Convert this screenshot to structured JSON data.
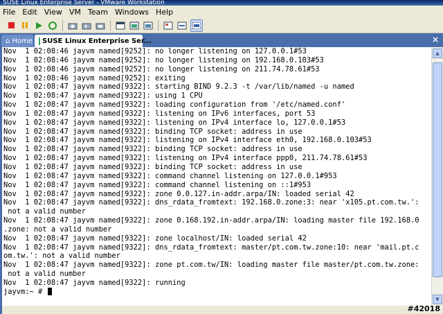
{
  "window": {
    "title": "SUSE Linux Enterprise Server - VMware Workstation"
  },
  "menu": [
    "File",
    "Edit",
    "View",
    "VM",
    "Team",
    "Windows",
    "Help"
  ],
  "toolbar": {
    "icons": [
      "stop-icon",
      "pause-icon",
      "play-icon",
      "reset-icon",
      "snapshot-icon",
      "revert-snapshot-icon",
      "snapshot-manager-icon",
      "fullscreen-icon",
      "quick-switch-icon",
      "summary-view-icon",
      "console-view-icon",
      "appliance-view-icon"
    ]
  },
  "tabs": [
    {
      "label": "Home",
      "icon": "home-icon"
    },
    {
      "label": "SUSE Linux Enterprise Ser...",
      "icon": "vm-icon"
    }
  ],
  "console": {
    "lines": [
      "Nov  1 02:08:46 jayvm named[9252]: no longer listening on 127.0.0.1#53",
      "Nov  1 02:08:46 jayvm named[9252]: no longer listening on 192.168.0.103#53",
      "Nov  1 02:08:46 jayvm named[9252]: no longer listening on 211.74.78.61#53",
      "Nov  1 02:08:46 jayvm named[9252]: exiting",
      "Nov  1 02:08:47 jayvm named[9322]: starting BIND 9.2.3 -t /var/lib/named -u named",
      "Nov  1 02:08:47 jayvm named[9322]: using 1 CPU",
      "Nov  1 02:08:47 jayvm named[9322]: loading configuration from '/etc/named.conf'",
      "Nov  1 02:08:47 jayvm named[9322]: listening on IPv6 interfaces, port 53",
      "Nov  1 02:08:47 jayvm named[9322]: listening on IPv4 interface lo, 127.0.0.1#53",
      "Nov  1 02:08:47 jayvm named[9322]: binding TCP socket: address in use",
      "Nov  1 02:08:47 jayvm named[9322]: listening on IPv4 interface eth0, 192.168.0.103#53",
      "Nov  1 02:08:47 jayvm named[9322]: binding TCP socket: address in use",
      "Nov  1 02:08:47 jayvm named[9322]: listening on IPv4 interface ppp0, 211.74.78.61#53",
      "Nov  1 02:08:47 jayvm named[9322]: binding TCP socket: address in use",
      "Nov  1 02:08:47 jayvm named[9322]: command channel listening on 127.0.0.1#953",
      "Nov  1 02:08:47 jayvm named[9322]: command channel listening on ::1#953",
      "Nov  1 02:08:47 jayvm named[9322]: zone 0.0.127.in-addr.arpa/IN: loaded serial 42",
      "Nov  1 02:08:47 jayvm named[9322]: dns_rdata_fromtext: 192.168.0.zone:3: near 'x105.pt.com.tw.':",
      " not a valid number",
      "Nov  1 02:08:47 jayvm named[9322]: zone 0.168.192.in-addr.arpa/IN: loading master file 192.168.0",
      ".zone: not a valid number",
      "Nov  1 02:08:47 jayvm named[9322]: zone localhost/IN: loaded serial 42",
      "Nov  1 02:08:47 jayvm named[9322]: dns_rdata_fromtext: master/pt.com.tw.zone:10: near 'mail.pt.c",
      "om.tw.': not a valid number",
      "Nov  1 02:08:47 jayvm named[9322]: zone pt.com.tw/IN: loading master file master/pt.com.tw.zone:",
      " not a valid number",
      "Nov  1 02:08:47 jayvm named[9322]: running"
    ],
    "prompt": "jayvm:~ # "
  },
  "watermark": "#42018",
  "colors": {
    "tab_bar": "#4a6ea9",
    "console_bg": "#ffffff",
    "console_fg": "#000000"
  }
}
